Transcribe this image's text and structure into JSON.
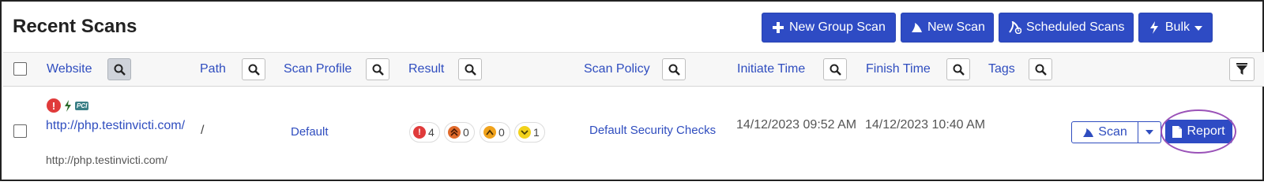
{
  "page": {
    "title": "Recent Scans"
  },
  "toolbar": {
    "new_group_scan": "New Group Scan",
    "new_scan": "New Scan",
    "scheduled_scans": "Scheduled Scans",
    "bulk": "Bulk"
  },
  "columns": {
    "website": "Website",
    "path": "Path",
    "scan_profile": "Scan Profile",
    "result": "Result",
    "scan_policy": "Scan Policy",
    "initiate_time": "Initiate Time",
    "finish_time": "Finish Time",
    "tags": "Tags"
  },
  "rows": [
    {
      "website_url": "http://php.testinvicti.com/",
      "website_sub": "http://php.testinvicti.com/",
      "pci_badge": "PCI",
      "path": "/",
      "scan_profile": "Default",
      "results": {
        "critical": "4",
        "high": "0",
        "medium": "0",
        "low": "1"
      },
      "scan_policy": "Default Security Checks",
      "initiate_time": "14/12/2023 09:52 AM",
      "finish_time": "14/12/2023 10:40 AM",
      "scan_button": "Scan",
      "report_button": "Report"
    }
  ],
  "colors": {
    "primary": "#2e4bc4",
    "link": "#2f4dbf",
    "critical": "#e03b3b",
    "high": "#e06a2b",
    "medium": "#f0a21b",
    "low": "#f2d21b",
    "highlight": "#9a52b8"
  },
  "icons": {
    "toolbar": [
      "plus-icon",
      "shark-fin-icon",
      "scheduled-icon",
      "bolt-icon",
      "caret-down-icon"
    ],
    "header": [
      "search-icon",
      "filter-icon"
    ],
    "row": [
      "error-icon",
      "bolt-icon",
      "pci-icon",
      "shark-fin-icon",
      "caret-down-icon",
      "document-icon"
    ]
  }
}
